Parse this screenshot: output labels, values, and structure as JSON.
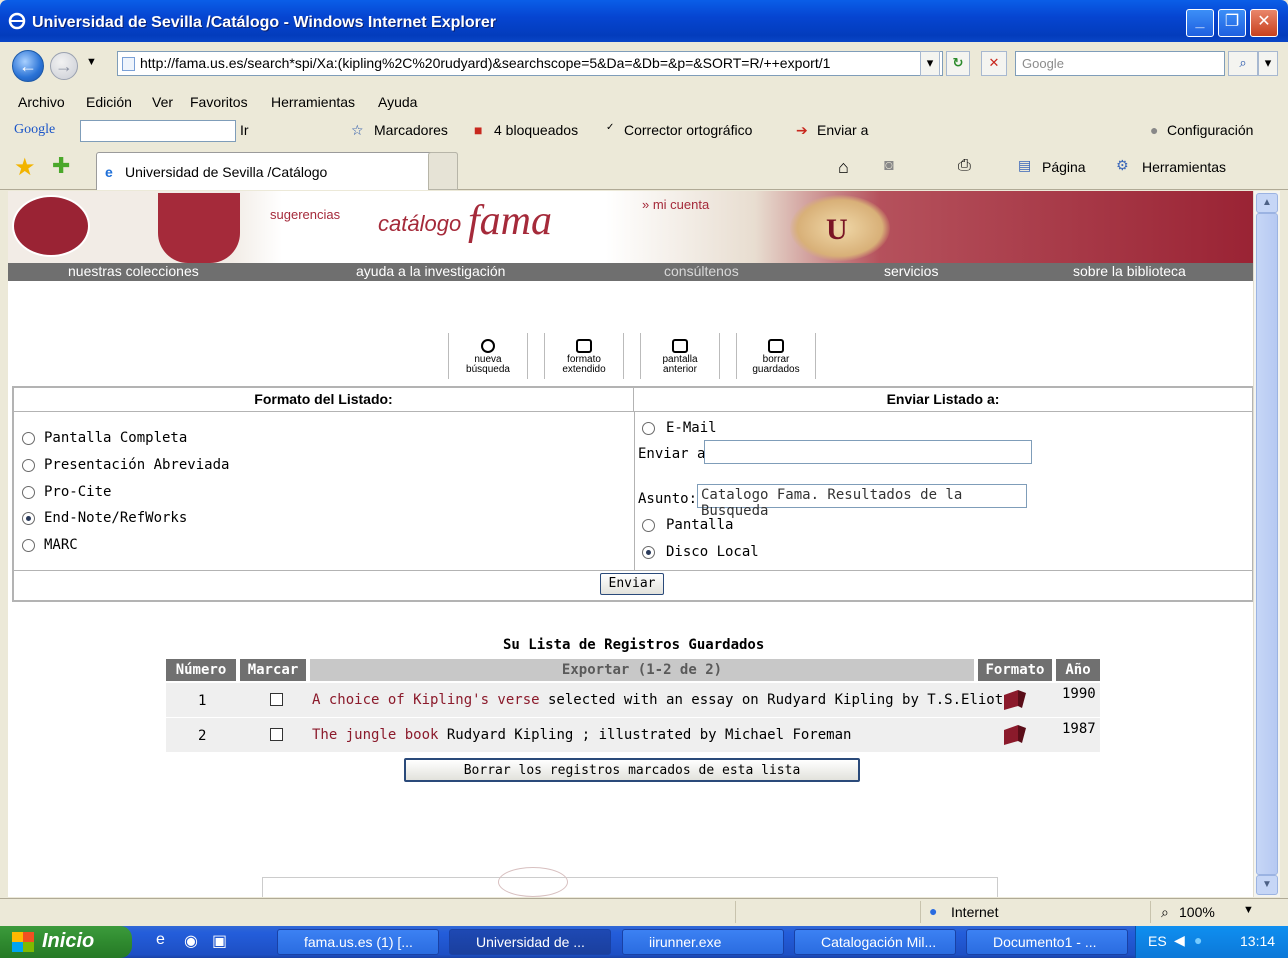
{
  "window": {
    "title": "Universidad de Sevilla /Catálogo - Windows Internet Explorer"
  },
  "address": {
    "url": "http://fama.us.es/search*spi/Xa:(kipling%2C%20rudyard)&searchscope=5&Da=&Db=&p=&SORT=R/++export/1",
    "search_placeholder": "Google"
  },
  "menu": [
    "Archivo",
    "Edición",
    "Ver",
    "Favoritos",
    "Herramientas",
    "Ayuda"
  ],
  "google_toolbar": {
    "brand": "Google",
    "go": "Ir",
    "bookmarks": "Marcadores",
    "blocked": "4 bloqueados",
    "spell": "Corrector ortográfico",
    "send": "Enviar a",
    "settings": "Configuración"
  },
  "tab": {
    "label": "Universidad de Sevilla /Catálogo"
  },
  "command_bar": {
    "page": "Página",
    "tools": "Herramientas"
  },
  "banner": {
    "suggestions": "sugerencias",
    "catalog": "catálogo",
    "fama": "fama",
    "account": "» mi cuenta"
  },
  "nav": [
    "nuestras colecciones",
    "ayuda a la investigación",
    "consúltenos",
    "servicios",
    "sobre la biblioteca"
  ],
  "icons": [
    {
      "line1": "nueva",
      "line2": "búsqueda"
    },
    {
      "line1": "formato",
      "line2": "extendido"
    },
    {
      "line1": "pantalla",
      "line2": "anterior"
    },
    {
      "line1": "borrar",
      "line2": "guardados"
    }
  ],
  "format": {
    "header": "Formato del Listado:",
    "options": [
      "Pantalla Completa",
      "Presentación Abreviada",
      "Pro-Cite",
      "End-Note/RefWorks",
      "MARC"
    ],
    "selected": "End-Note/RefWorks"
  },
  "send": {
    "header": "Enviar Listado a:",
    "email": "E-Mail",
    "to_label": "Enviar a:",
    "to_value": "",
    "subject_label": "Asunto:",
    "subject_value": "Catalogo Fama. Resultados de la Busqueda",
    "screen": "Pantalla",
    "disk": "Disco Local",
    "selected": "Disco Local",
    "button": "Enviar"
  },
  "saved": {
    "title": "Su Lista de Registros Guardados",
    "columns": [
      "Número",
      "Marcar",
      "Exportar (1-2 de 2)",
      "Formato",
      "Año"
    ],
    "rows": [
      {
        "num": "1",
        "link": "A choice of Kipling's verse",
        "rest": " selected with an essay on Rudyard Kipling by T.S.Eliot",
        "year": "1990"
      },
      {
        "num": "2",
        "link": "The jungle book",
        "rest": " Rudyard Kipling ; illustrated by Michael Foreman",
        "year": "1987"
      }
    ],
    "delete_button": "Borrar los registros marcados de esta lista"
  },
  "status": {
    "zone": "Internet",
    "zoom": "100%"
  },
  "taskbar": {
    "start": "Inicio",
    "tasks": [
      "fama.us.es (1) [...",
      "Universidad de ...",
      "iirunner.exe",
      "Catalogación Mil...",
      "Documento1 - ..."
    ],
    "lang": "ES",
    "clock": "13:14"
  }
}
